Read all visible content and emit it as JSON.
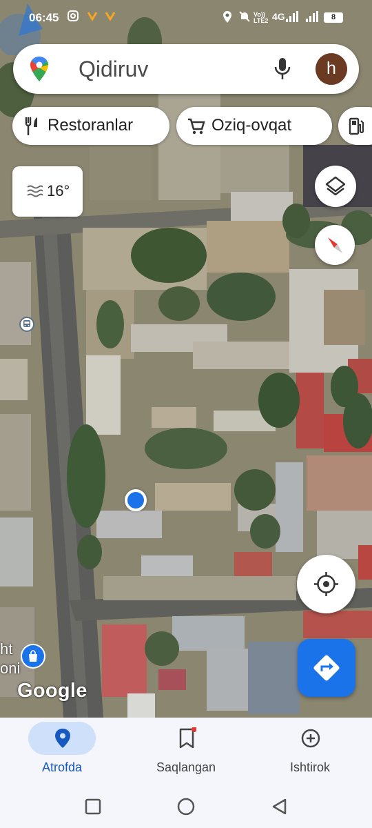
{
  "status_bar": {
    "time": "06:45",
    "network": "4G",
    "volte": "Vo)) LTE2",
    "battery": "8"
  },
  "search": {
    "placeholder": "Qidiruv",
    "avatar_letter": "h"
  },
  "chips": [
    {
      "label": "Restoranlar",
      "icon": "restaurant-icon"
    },
    {
      "label": "Oziq-ovqat",
      "icon": "cart-icon"
    },
    {
      "label": "",
      "icon": "gas-station-icon"
    }
  ],
  "weather": {
    "temperature": "16°",
    "icon": "haze-icon"
  },
  "map": {
    "place_label_line1": "ht",
    "place_label_line2": "oni",
    "google_logo": "Google"
  },
  "bottom_nav": [
    {
      "label": "Atrofda",
      "icon": "location-pin-icon",
      "active": true
    },
    {
      "label": "Saqlangan",
      "icon": "bookmark-icon",
      "active": false
    },
    {
      "label": "Ishtirok",
      "icon": "add-circle-icon",
      "active": false
    }
  ],
  "colors": {
    "accent": "#1a73e8",
    "active_nav_bg": "#cfe0fb",
    "nav_bg": "#f4f6fb",
    "avatar": "#6b3a22"
  }
}
